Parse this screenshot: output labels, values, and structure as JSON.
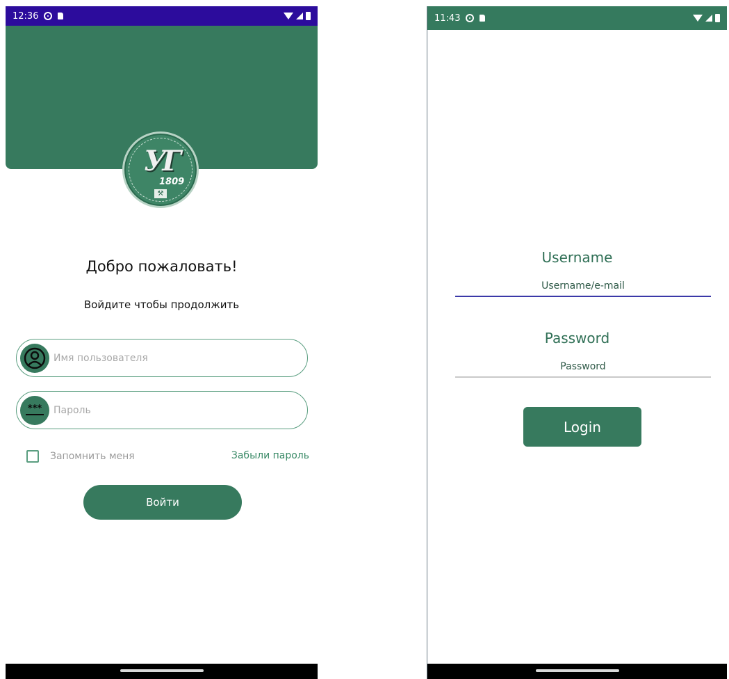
{
  "left_screen": {
    "status_bar": {
      "time": "12:36"
    },
    "logo": {
      "letters": "УГ",
      "year": "1809",
      "emblem": "⚒"
    },
    "welcome_title": "Добро пожаловать!",
    "subtitle": "Войдите чтобы продолжить",
    "username_field": {
      "placeholder": "Имя пользователя",
      "icon": "user-circle-icon"
    },
    "password_field": {
      "placeholder": "Пароль",
      "icon_text": "***"
    },
    "remember_label": "Запомнить меня",
    "forgot_link": "Забыли пароль",
    "login_button": "Войти",
    "colors": {
      "primary": "#377a5e",
      "status_bar": "#2c0c9c"
    }
  },
  "right_screen": {
    "status_bar": {
      "time": "11:43"
    },
    "username_label": "Username",
    "username_value": "Username/e-mail",
    "password_label": "Password",
    "password_value": "Password",
    "login_button": "Login",
    "colors": {
      "primary": "#377a5e",
      "focus_underline": "#3b39a8"
    }
  }
}
